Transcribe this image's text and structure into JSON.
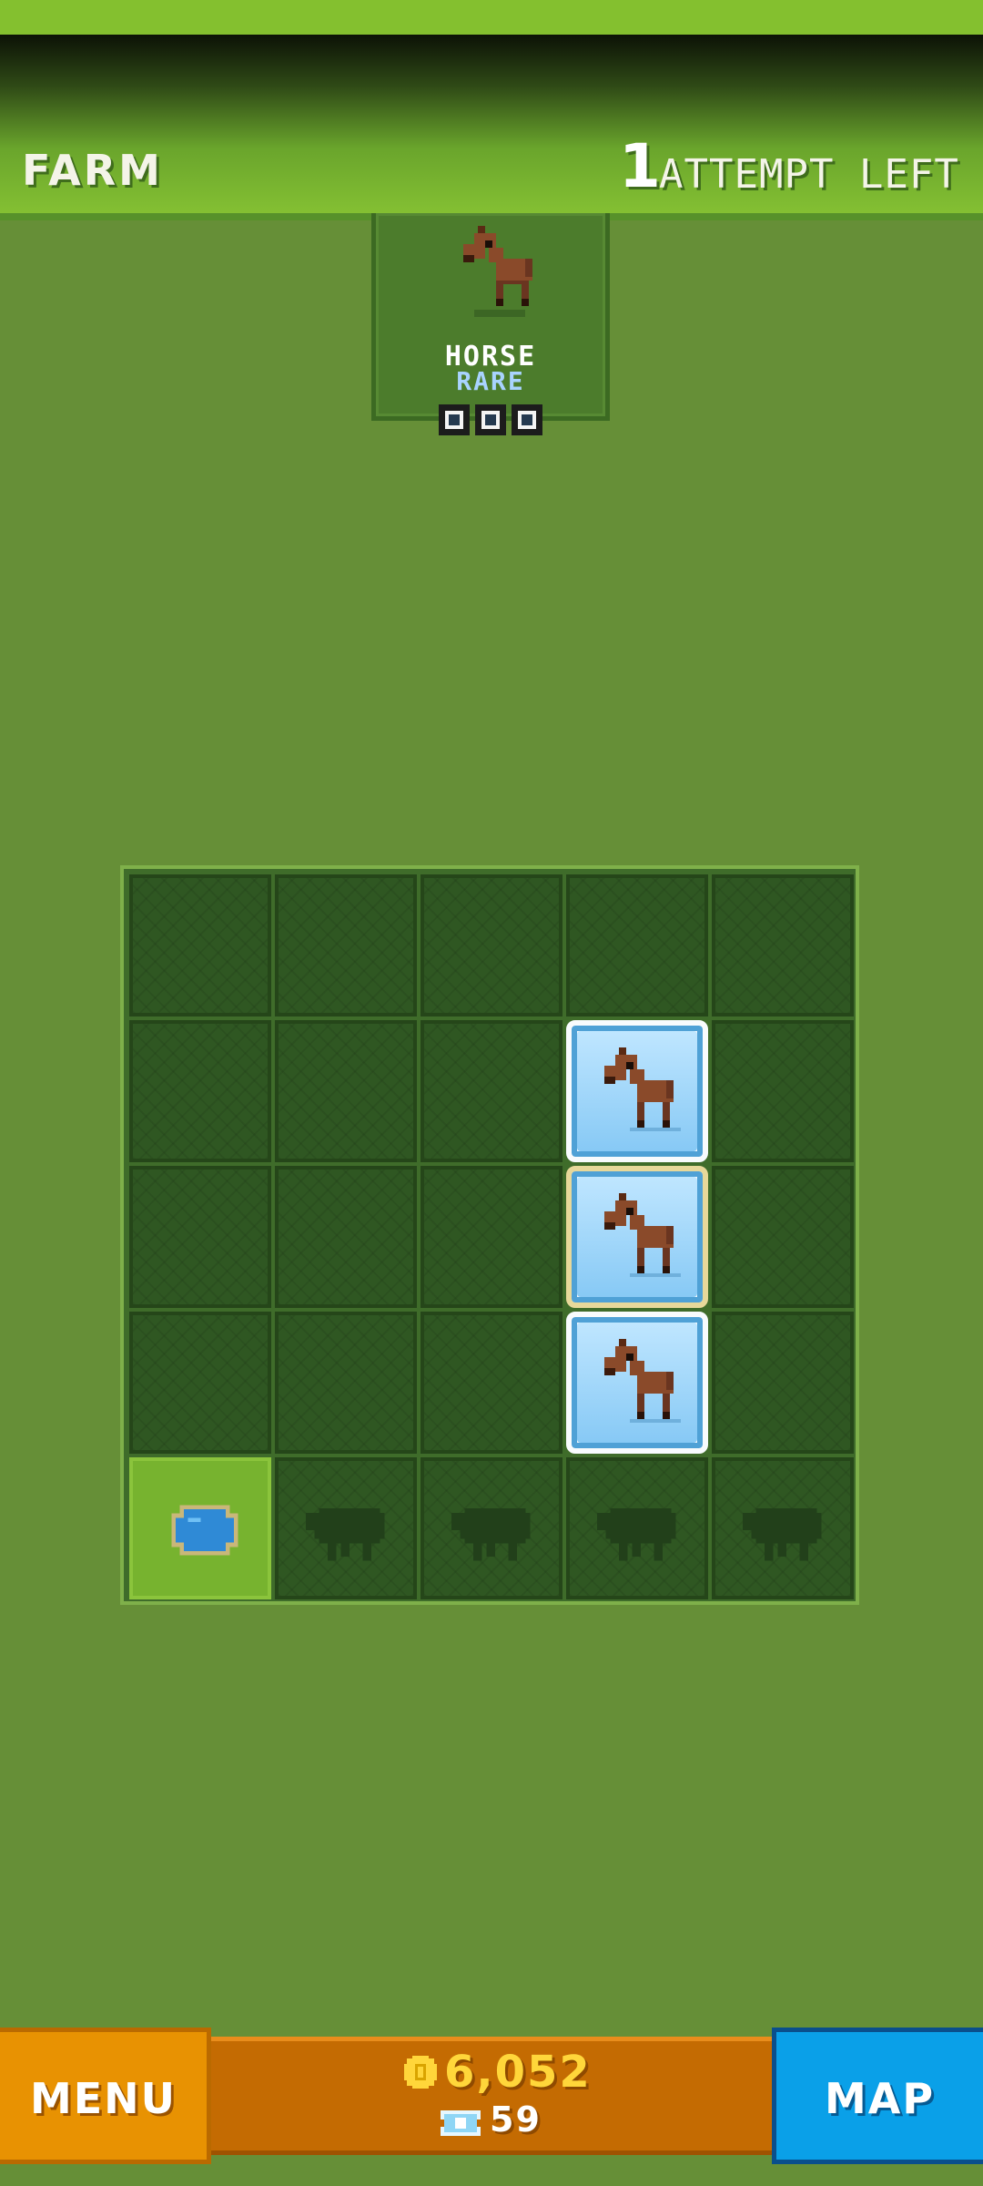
{
  "header": {
    "title": "FARM",
    "attempts_count": "1",
    "attempts_label": "ATTEMPT LEFT"
  },
  "target": {
    "animal_name": "HORSE",
    "rarity": "RARE",
    "icon": "horse-icon",
    "progress_pips": 3
  },
  "board": {
    "rows": 5,
    "cols": 5,
    "cells": [
      [
        "empty",
        "empty",
        "empty",
        "empty",
        "empty"
      ],
      [
        "empty",
        "empty",
        "empty",
        "horse",
        "empty"
      ],
      [
        "empty",
        "empty",
        "empty",
        "horse",
        "empty"
      ],
      [
        "empty",
        "empty",
        "empty",
        "horse",
        "empty"
      ],
      [
        "pond",
        "sheep-silhouette",
        "sheep-silhouette",
        "sheep-silhouette",
        "sheep-silhouette"
      ]
    ]
  },
  "bottom_bar": {
    "menu_label": "MENU",
    "coins": "6,052",
    "tickets": "59",
    "map_label": "MAP"
  },
  "colors": {
    "background": "#668f37",
    "menu_button": "#e89202",
    "map_button": "#0aa0e8",
    "coin_text": "#ffd63a",
    "rarity_text": "#a9d3ff"
  }
}
